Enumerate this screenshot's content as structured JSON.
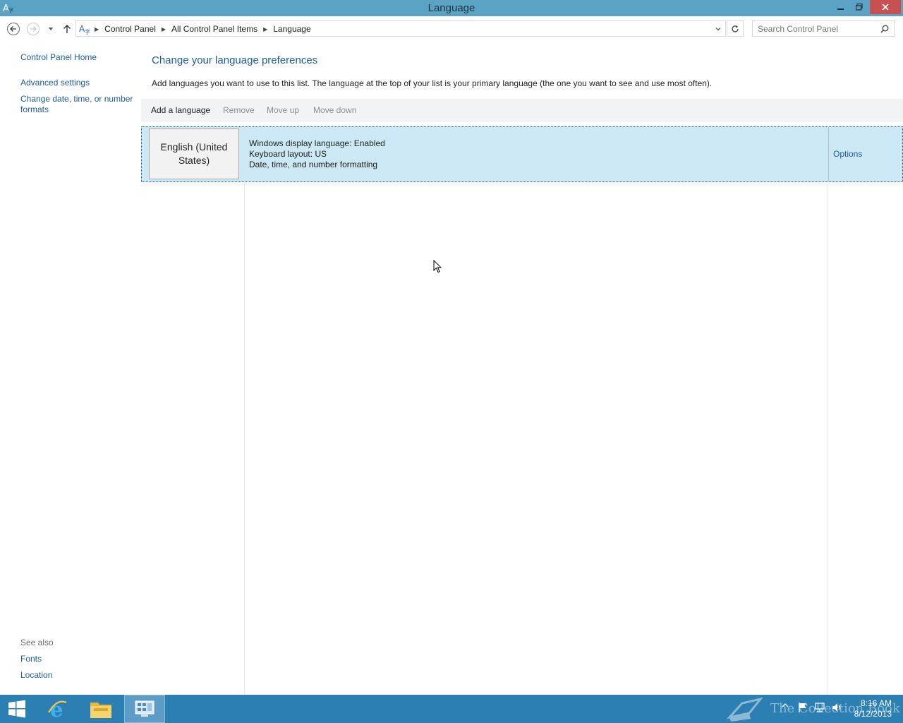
{
  "window": {
    "title": "Language",
    "controls": {
      "minimize_icon": "minimize-icon",
      "restore_icon": "restore-icon",
      "close_icon": "close-icon"
    }
  },
  "navigation": {
    "breadcrumb": [
      "Control Panel",
      "All Control Panel Items",
      "Language"
    ],
    "search_placeholder": "Search Control Panel"
  },
  "sidebar": {
    "links": [
      "Control Panel Home",
      "Advanced settings",
      "Change date, time, or number formats"
    ],
    "see_also_label": "See also",
    "see_also_links": [
      "Fonts",
      "Location"
    ]
  },
  "main": {
    "heading": "Change your language preferences",
    "description": "Add languages you want to use to this list. The language at the top of your list is your primary language (the one you want to see and use most often).",
    "toolbar": {
      "add": "Add a language",
      "remove": "Remove",
      "move_up": "Move up",
      "move_down": "Move down"
    },
    "languages": [
      {
        "name": "English (United States)",
        "details": [
          "Windows display language: Enabled",
          "Keyboard layout: US",
          "Date, time, and number formatting"
        ],
        "options_label": "Options"
      }
    ]
  },
  "taskbar": {
    "clock_time": "8:16 AM",
    "clock_date": "8/12/2013",
    "watermark": "The Collection Book"
  },
  "colors": {
    "titlebar": "#5ba3c4",
    "link": "#1c5d99",
    "selection": "#cce8f4",
    "taskbar": "#2b7fb2",
    "close_button": "#c75050"
  }
}
